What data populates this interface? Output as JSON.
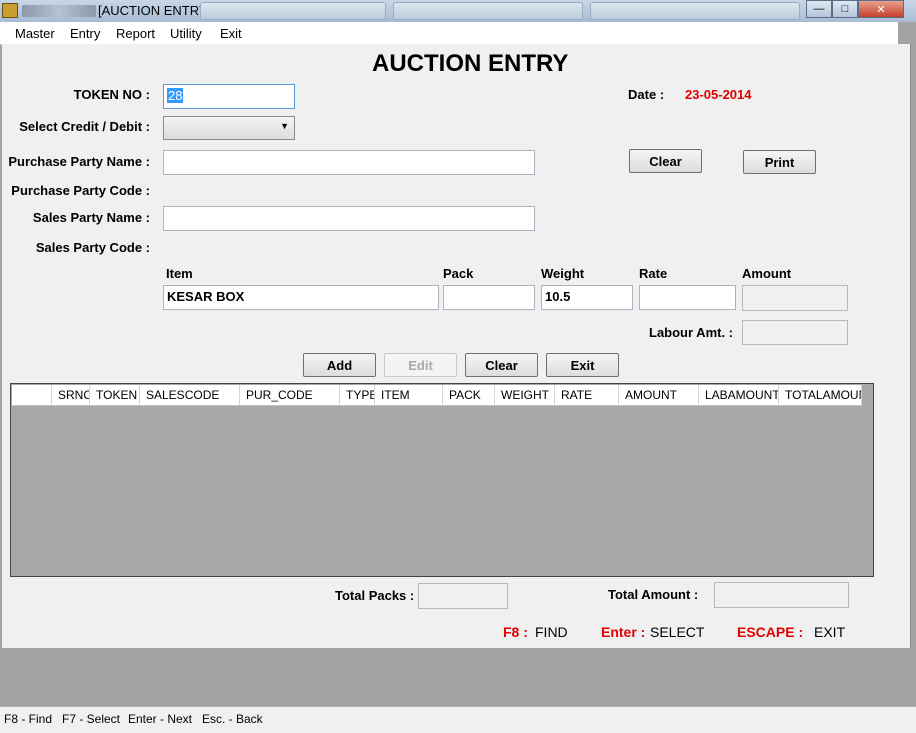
{
  "window": {
    "title": "[AUCTION ENTRY]",
    "controls": {
      "minimize": "—",
      "maximize": "□",
      "close": "✕"
    }
  },
  "menu": [
    "Master",
    "Entry",
    "Report",
    "Utility",
    "Exit"
  ],
  "form": {
    "heading": "AUCTION ENTRY",
    "token_label": "TOKEN NO :",
    "token_value": "28",
    "date_label": "Date :",
    "date_value": "23-05-2014",
    "credit_debit_label": "Select Credit / Debit :",
    "credit_debit_value": "",
    "purchase_party_name_label": "Purchase Party Name :",
    "purchase_party_name_value": "",
    "purchase_party_code_label": "Purchase Party Code :",
    "sales_party_name_label": "Sales Party Name :",
    "sales_party_name_value": "",
    "sales_party_code_label": "Sales Party Code :",
    "clear_top_label": "Clear",
    "print_label": "Print",
    "item_header": "Item",
    "pack_header": "Pack",
    "weight_header": "Weight",
    "rate_header": "Rate",
    "amount_header": "Amount",
    "item_value": "KESAR BOX",
    "pack_value": "",
    "weight_value": "10.5",
    "rate_value": "",
    "amount_value": "",
    "labour_label": "Labour Amt. :",
    "labour_value": "",
    "add_label": "Add",
    "edit_label": "Edit",
    "clear_label": "Clear",
    "exit_label": "Exit"
  },
  "grid": {
    "columns": [
      "SRNO",
      "TOKEN",
      "SALESCODE",
      "PUR_CODE",
      "TYPE",
      "ITEM",
      "PACK",
      "WEIGHT",
      "RATE",
      "AMOUNT",
      "LABAMOUNT",
      "TOTALAMOUN"
    ],
    "rows": []
  },
  "totals": {
    "packs_label": "Total Packs :",
    "packs_value": "",
    "amount_label": "Total Amount :",
    "amount_value": ""
  },
  "hints": {
    "f8_key": "F8 :",
    "f8_action": "FIND",
    "enter_key": "Enter :",
    "enter_action": "SELECT",
    "escape_key": "ESCAPE :",
    "escape_action": "EXIT"
  },
  "statusbar": [
    "F8 - Find",
    "F7 - Select",
    "Enter - Next",
    "Esc. - Back"
  ],
  "colors": {
    "accent_red": "#e00000",
    "token_highlight": "#3399ff"
  }
}
